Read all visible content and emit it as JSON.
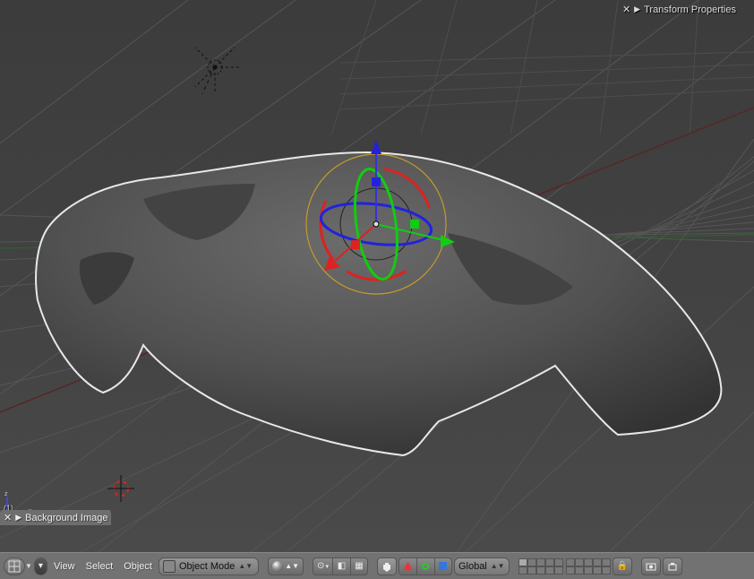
{
  "panels": {
    "transform_properties": "Transform Properties",
    "background_image": "Background Image"
  },
  "menus": {
    "view": "View",
    "select": "Select",
    "object": "Object"
  },
  "mode": {
    "label": "Object Mode"
  },
  "orientation": {
    "label": "Global"
  },
  "axis_label": "(1)",
  "gizmo_axes": {
    "x": "x",
    "y": "y",
    "z": "z"
  },
  "manip_shapes": {
    "translate": "▲",
    "rotate": "○",
    "scale": "■"
  }
}
